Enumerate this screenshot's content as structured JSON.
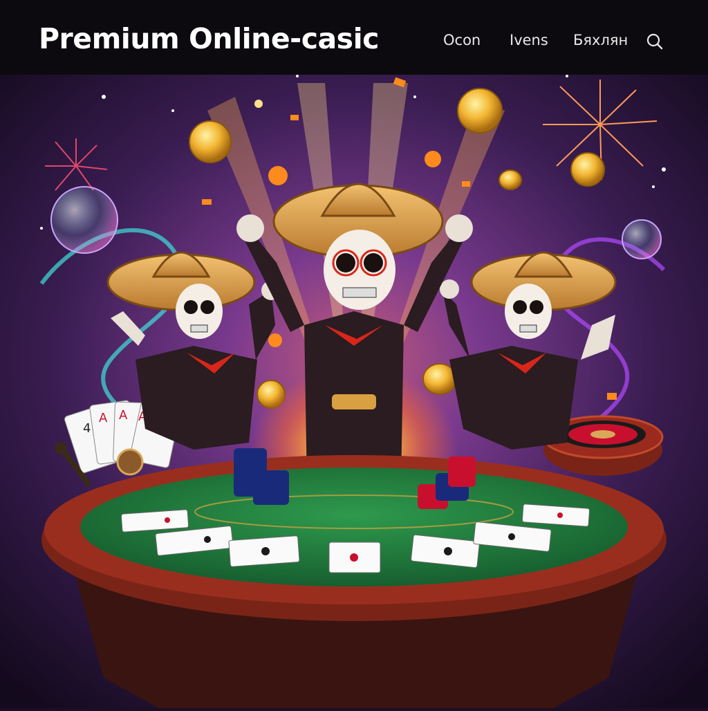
{
  "header": {
    "brand": "Premium Online-casic",
    "nav": [
      {
        "label": "Ocon"
      },
      {
        "label": "Ivens"
      },
      {
        "label": "Бяхлян"
      }
    ],
    "search_icon": "search-icon"
  },
  "hero": {
    "characters": [
      "skeleton-mariachi-left",
      "skeleton-mariachi-center",
      "skeleton-mariachi-right"
    ],
    "table": "blackjack-table",
    "card_fan_ranks": [
      "4",
      "A",
      "A",
      "A"
    ]
  },
  "colors": {
    "header_bg": "#0c0a0f",
    "felt": "#1f7a3a",
    "table_rail": "#7a2418",
    "gold": "#f2b531",
    "sky": "#3a1d52"
  }
}
